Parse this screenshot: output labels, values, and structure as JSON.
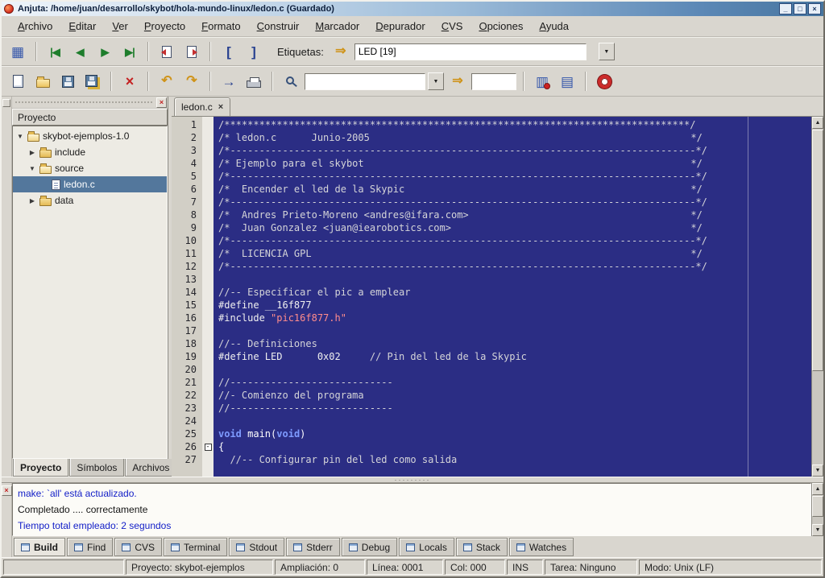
{
  "window": {
    "title": "Anjuta: /home/juan/desarrollo/skybot/hola-mundo-linux/ledon.c (Guardado)",
    "controls": {
      "minimize": "_",
      "maximize": "□",
      "close": "×"
    }
  },
  "menu": {
    "items": [
      "Archivo",
      "Editar",
      "Ver",
      "Proyecto",
      "Formato",
      "Construir",
      "Marcador",
      "Depurador",
      "CVS",
      "Opciones",
      "Ayuda"
    ]
  },
  "icons": {
    "grid": "▦",
    "nav_first": "|◀",
    "nav_prev": "◀",
    "nav_next": "▶",
    "nav_last": "▶|",
    "bracket_open": "[",
    "bracket_close": "]",
    "jump": "⇒",
    "undo": "↶",
    "redo": "↷",
    "goto": "→",
    "close": "×",
    "dropdown": "▼",
    "up": "▲",
    "down": "▼",
    "list": "▤",
    "clip": "▥"
  },
  "toolbar_tags": {
    "label": "Etiquetas:",
    "value": "LED [19]"
  },
  "toolbar_search": {
    "value": "",
    "entry2": ""
  },
  "sidebar": {
    "header": "Proyecto",
    "tree": [
      {
        "expander": "▼",
        "icon": "folder-open",
        "label": "skybot-ejemplos-1.0",
        "level": 0
      },
      {
        "expander": "▶",
        "icon": "folder",
        "label": "include",
        "level": 1
      },
      {
        "expander": "▼",
        "icon": "folder-open",
        "label": "source",
        "level": 1
      },
      {
        "expander": "",
        "icon": "file",
        "label": "ledon.c",
        "level": 2,
        "selected": true
      },
      {
        "expander": "▶",
        "icon": "folder",
        "label": "data",
        "level": 1
      }
    ],
    "tabs": [
      {
        "label": "Proyecto",
        "active": true
      },
      {
        "label": "Símbolos"
      },
      {
        "label": "Archivos"
      }
    ]
  },
  "editor": {
    "tab": "ledon.c",
    "lines": [
      {
        "n": 1,
        "parts": [
          {
            "t": "/********************************************************************************/",
            "c": "cm"
          }
        ]
      },
      {
        "n": 2,
        "parts": [
          {
            "t": "/* ledon.c      Junio-2005",
            "c": "cm"
          },
          {
            "t": "",
            "c": "fill"
          },
          {
            "t": "*/",
            "c": "cm"
          }
        ]
      },
      {
        "n": 3,
        "parts": [
          {
            "t": "/*--------------------------------------------------------------------------------*/",
            "c": "cm"
          }
        ]
      },
      {
        "n": 4,
        "parts": [
          {
            "t": "/* Ejemplo para el skybot",
            "c": "cm"
          },
          {
            "t": "",
            "c": "fill"
          },
          {
            "t": "*/",
            "c": "cm"
          }
        ]
      },
      {
        "n": 5,
        "parts": [
          {
            "t": "/*--------------------------------------------------------------------------------*/",
            "c": "cm"
          }
        ]
      },
      {
        "n": 6,
        "parts": [
          {
            "t": "/*  Encender el led de la Skypic",
            "c": "cm"
          },
          {
            "t": "",
            "c": "fill"
          },
          {
            "t": "*/",
            "c": "cm"
          }
        ]
      },
      {
        "n": 7,
        "parts": [
          {
            "t": "/*--------------------------------------------------------------------------------*/",
            "c": "cm"
          }
        ]
      },
      {
        "n": 8,
        "parts": [
          {
            "t": "/*  Andres Prieto-Moreno <andres@ifara.com>",
            "c": "cm"
          },
          {
            "t": "",
            "c": "fill"
          },
          {
            "t": "*/",
            "c": "cm"
          }
        ]
      },
      {
        "n": 9,
        "parts": [
          {
            "t": "/*  Juan Gonzalez <juan@iearobotics.com>",
            "c": "cm"
          },
          {
            "t": "",
            "c": "fill"
          },
          {
            "t": "*/",
            "c": "cm"
          }
        ]
      },
      {
        "n": 10,
        "parts": [
          {
            "t": "/*--------------------------------------------------------------------------------*/",
            "c": "cm"
          }
        ]
      },
      {
        "n": 11,
        "parts": [
          {
            "t": "/*  LICENCIA GPL",
            "c": "cm"
          },
          {
            "t": "",
            "c": "fill"
          },
          {
            "t": "*/",
            "c": "cm"
          }
        ]
      },
      {
        "n": 12,
        "parts": [
          {
            "t": "/*--------------------------------------------------------------------------------*/",
            "c": "cm"
          }
        ]
      },
      {
        "n": 13,
        "parts": []
      },
      {
        "n": 14,
        "parts": [
          {
            "t": "//-- Especificar el pic a emplear",
            "c": "cm"
          }
        ]
      },
      {
        "n": 15,
        "parts": [
          {
            "t": "#define __16f877",
            "c": "pp"
          }
        ]
      },
      {
        "n": 16,
        "parts": [
          {
            "t": "#include ",
            "c": "pp"
          },
          {
            "t": "\"pic16f877.h\"",
            "c": "st"
          }
        ]
      },
      {
        "n": 17,
        "parts": []
      },
      {
        "n": 18,
        "parts": [
          {
            "t": "//-- Definiciones",
            "c": "cm"
          }
        ]
      },
      {
        "n": 19,
        "parts": [
          {
            "t": "#define LED      0x02     ",
            "c": "pp"
          },
          {
            "t": "// Pin del led de la Skypic",
            "c": "cm"
          }
        ]
      },
      {
        "n": 20,
        "parts": []
      },
      {
        "n": 21,
        "parts": [
          {
            "t": "//----------------------------",
            "c": "cm"
          }
        ]
      },
      {
        "n": 22,
        "parts": [
          {
            "t": "//- Comienzo del programa",
            "c": "cm"
          }
        ]
      },
      {
        "n": 23,
        "parts": [
          {
            "t": "//----------------------------",
            "c": "cm"
          }
        ]
      },
      {
        "n": 24,
        "parts": []
      },
      {
        "n": 25,
        "parts": [
          {
            "t": "void",
            "c": "kw"
          },
          {
            "t": " main(",
            "c": "tx"
          },
          {
            "t": "void",
            "c": "kw"
          },
          {
            "t": ")",
            "c": "tx"
          }
        ]
      },
      {
        "n": 26,
        "fold": "-",
        "parts": [
          {
            "t": "{",
            "c": "tx"
          }
        ]
      },
      {
        "n": 27,
        "parts": [
          {
            "t": "  //-- Configurar pin del led como salida",
            "c": "cm"
          }
        ]
      }
    ]
  },
  "messages": {
    "lines": [
      {
        "t": "make: `all' está actualizado.",
        "c": "blue"
      },
      {
        "t": "Completado .... correctamente",
        "c": "black"
      },
      {
        "t": "Tiempo total empleado: 2 segundos",
        "c": "blue"
      }
    ]
  },
  "panel_tabs": [
    {
      "label": "Build",
      "active": true
    },
    {
      "label": "Find"
    },
    {
      "label": "CVS"
    },
    {
      "label": "Terminal"
    },
    {
      "label": "Stdout"
    },
    {
      "label": "Stderr"
    },
    {
      "label": "Debug"
    },
    {
      "label": "Locals"
    },
    {
      "label": "Stack"
    },
    {
      "label": "Watches"
    }
  ],
  "statusbar": {
    "cells": [
      "",
      "Proyecto: skybot-ejemplos",
      "Ampliación: 0",
      "Línea: 0001",
      "Col: 000",
      "INS",
      "Tarea: Ninguno",
      "Modo: Unix (LF)"
    ]
  }
}
